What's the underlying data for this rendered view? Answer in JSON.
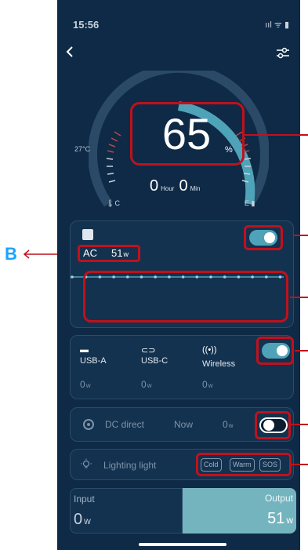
{
  "status_bar": {
    "time": "15:56",
    "icons": "ııl ᯤ ▮"
  },
  "gauge": {
    "percent": "65",
    "percent_unit": "%",
    "temperature": "27°C",
    "hours": "0",
    "hour_unit": "Hour",
    "minutes": "0",
    "minute_unit": "Min",
    "low_label": "C",
    "high_label": "E",
    "level": 0.65
  },
  "ac": {
    "label": "AC",
    "watts": "51",
    "unit": "w",
    "toggle_on": true
  },
  "usb": {
    "ports": [
      {
        "label": "USB-A",
        "watts": "0",
        "unit": "w"
      },
      {
        "label": "USB-C",
        "watts": "0",
        "unit": "w"
      },
      {
        "label": "Wireless",
        "watts": "0",
        "unit": "w"
      }
    ],
    "toggle_on": true
  },
  "dc": {
    "label": "DC direct",
    "now_label": "Now",
    "watts": "0",
    "unit": "w",
    "toggle_on": false
  },
  "lighting": {
    "label": "Lighting light",
    "modes": [
      "Cold",
      "Warm",
      "SOS"
    ]
  },
  "bottom": {
    "input_label": "Input",
    "input_value": "0",
    "input_unit": "w",
    "output_label": "Output",
    "output_value": "51",
    "output_unit": "w"
  },
  "annotation": {
    "letter": "B"
  },
  "colors": {
    "background": "#0e2a46",
    "accent": "#4fa3b8",
    "highlight": "#c0111c",
    "annotation": "#1aa3ff"
  }
}
